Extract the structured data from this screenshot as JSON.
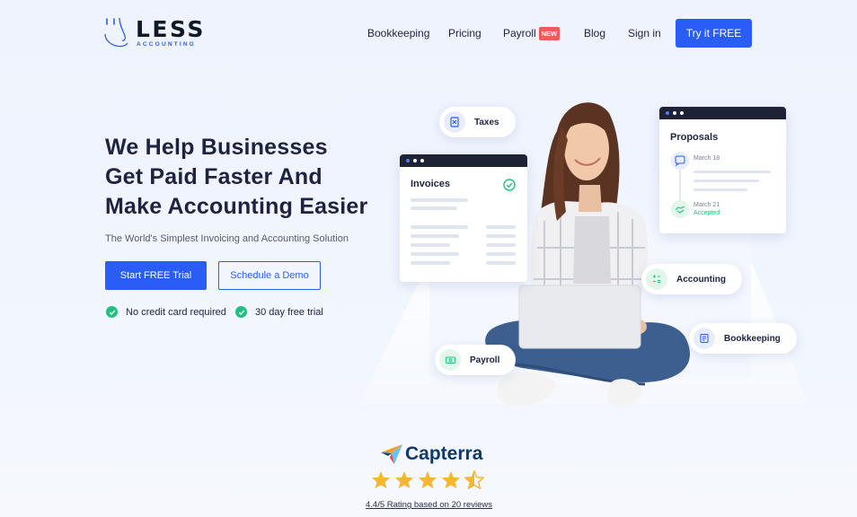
{
  "brand": {
    "name": "LESS",
    "sub": "ACCOUNTING",
    "accent": "#2a5df6"
  },
  "nav": {
    "bookkeeping": "Bookkeeping",
    "pricing": "Pricing",
    "payroll": "Payroll",
    "payroll_badge": "NEW",
    "blog": "Blog",
    "signin": "Sign in",
    "cta": "Try it FREE"
  },
  "hero": {
    "line1": "We Help Businesses",
    "line2": "Get Paid Faster And",
    "line3": "Make Accounting Easier",
    "subtitle": "The World's Simplest Invoicing and Accounting Solution",
    "primary_cta": "Start FREE Trial",
    "secondary_cta": "Schedule a Demo",
    "checks": [
      "No credit card required",
      "30 day free trial"
    ]
  },
  "illustration": {
    "taxes": "Taxes",
    "invoices": "Invoices",
    "proposals": {
      "title": "Proposals",
      "date1": "March 18",
      "date2": "March 21",
      "status": "Accepted"
    },
    "accounting": "Accounting",
    "bookkeeping": "Bookkeeping",
    "payroll": "Payroll"
  },
  "review": {
    "brand": "Capterra",
    "stars": 4.5,
    "rating_text": "4.4/5 Rating based on 20 reviews"
  },
  "colors": {
    "primary": "#2a5df6",
    "success": "#22c07f",
    "badge": "#ef5b5b",
    "star": "#f5b731"
  }
}
